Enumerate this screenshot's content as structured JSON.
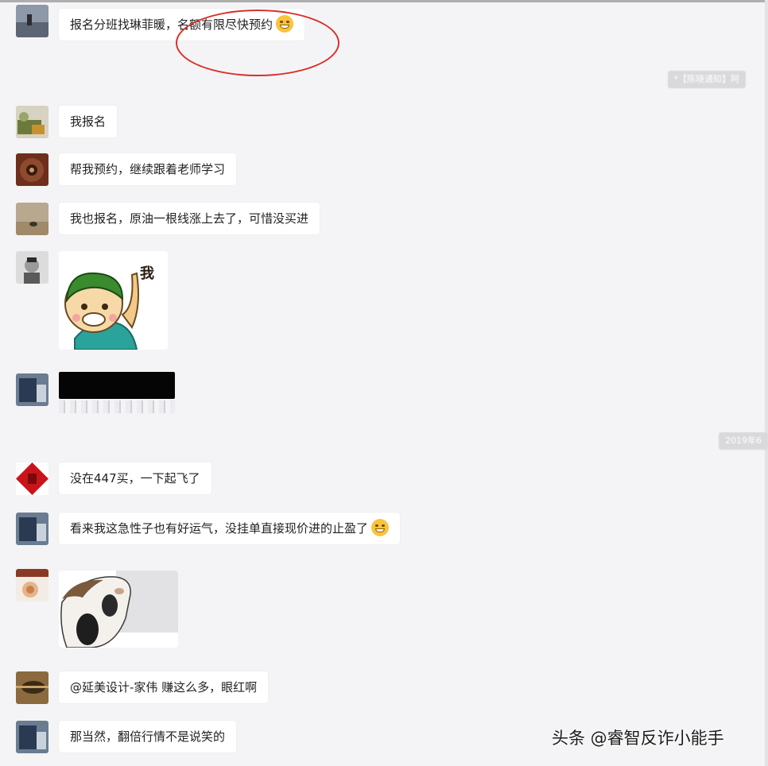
{
  "messages": [
    {
      "text": "报名分班找琳菲暖，名额有限尽快预约",
      "emoji": "smile-emoji"
    },
    {
      "text": "我报名"
    },
    {
      "text": "帮我预约，继续跟着老师学习"
    },
    {
      "text": "我也报名，原油一根线涨上去了，可惜没买进"
    },
    {
      "sticker_text": "我",
      "sticker": "raised-hand-sticker"
    },
    {
      "image": "blurred-screenshot"
    },
    {
      "text": "没在447买，一下起飞了"
    },
    {
      "text": "看来我这急性子也有好运气，没挂单直接现价进的止盈了",
      "emoji": "grin-emoji"
    },
    {
      "image": "cow-sticker"
    },
    {
      "text": "@延美设计-家伟  赚这么多，眼红啊"
    },
    {
      "text": "那当然，翻倍行情不是说笑的"
    }
  ],
  "system": {
    "notice": "*【陈晓通知】阿",
    "date": "2019年6"
  },
  "watermark": "头条 @睿智反诈小能手",
  "colors": {
    "background": "#f4f4f6",
    "bubble": "#ffffff",
    "annotation": "#d8312b"
  }
}
